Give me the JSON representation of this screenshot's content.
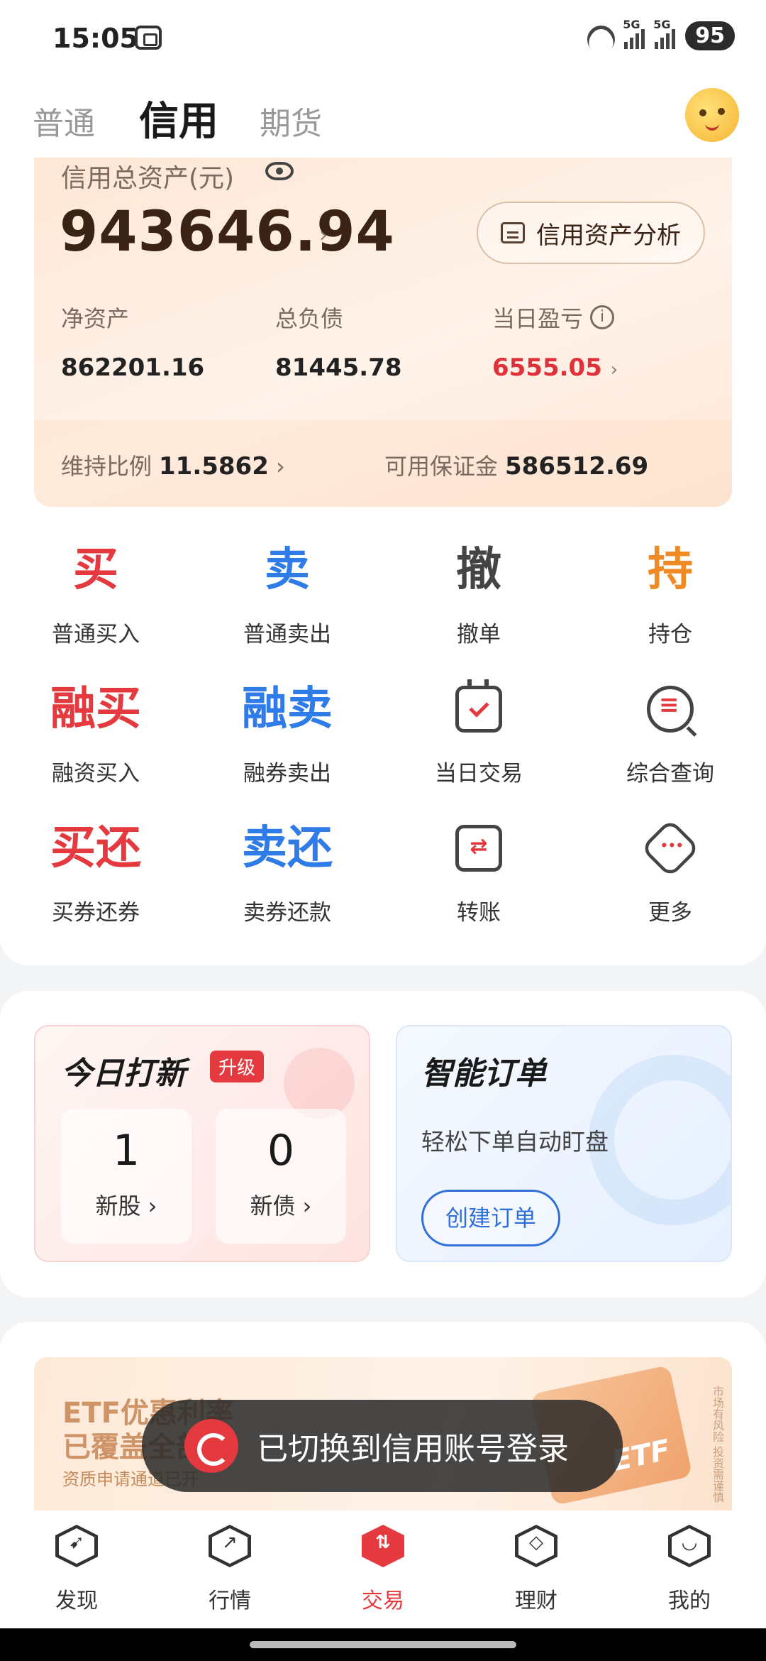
{
  "status_bar": {
    "time": "15:05",
    "screenshot_icon": "screenshot-icon",
    "signal_label_1": "5G",
    "signal_label_2": "5G",
    "battery": "95"
  },
  "top_tabs": {
    "items": [
      "普通",
      "信用",
      "期货"
    ],
    "active": "信用"
  },
  "asset_card": {
    "title": "信用总资产(元)",
    "total": "943646.94",
    "analysis_button": "信用资产分析",
    "stats": [
      {
        "label": "净资产",
        "value": "862201.16"
      },
      {
        "label": "总负债",
        "value": "81445.78"
      },
      {
        "label": "当日盈亏",
        "value": "6555.05"
      }
    ],
    "maintain_label": "维持比例",
    "maintain_value": "11.5862",
    "margin_label": "可用保证金",
    "margin_value": "586512.69"
  },
  "actions": [
    {
      "glyph": "买",
      "label": "普通买入"
    },
    {
      "glyph": "卖",
      "label": "普通卖出"
    },
    {
      "glyph": "撤",
      "label": "撤单"
    },
    {
      "glyph": "持",
      "label": "持仓"
    },
    {
      "glyph": "融买",
      "label": "融资买入"
    },
    {
      "glyph": "融卖",
      "label": "融券卖出"
    },
    {
      "icon": "calendar-check-icon",
      "label": "当日交易"
    },
    {
      "icon": "search-list-icon",
      "label": "综合查询"
    },
    {
      "glyph": "买还",
      "label": "买券还券"
    },
    {
      "glyph": "卖还",
      "label": "卖券还款"
    },
    {
      "icon": "transfer-icon",
      "label": "转账"
    },
    {
      "icon": "more-icon",
      "label": "更多"
    }
  ],
  "new_issue": {
    "title": "今日打新",
    "badge": "升级",
    "stocks_count": "1",
    "stocks_label": "新股 ›",
    "bonds_count": "0",
    "bonds_label": "新债 ›"
  },
  "smart_order": {
    "title": "智能订单",
    "desc": "轻松下单自动盯盘",
    "button": "创建订单"
  },
  "banner": {
    "line1": "ETF优惠利率",
    "line2": "已覆盖全部",
    "line3": "资质申请通道已开",
    "etf_label": "ETF",
    "note": "市场有风险 投资需谨慎"
  },
  "toast": {
    "text": "已切换到信用账号登录"
  },
  "bottom_tabs": [
    {
      "label": "发现",
      "icon": "compass-icon"
    },
    {
      "label": "行情",
      "icon": "trend-icon"
    },
    {
      "label": "交易",
      "icon": "trade-icon"
    },
    {
      "label": "理财",
      "icon": "wealth-icon"
    },
    {
      "label": "我的",
      "icon": "profile-icon"
    }
  ],
  "colors": {
    "buy_red": "#e43a3f",
    "sell_blue": "#2f7be8",
    "hold_orange": "#f08a24"
  }
}
